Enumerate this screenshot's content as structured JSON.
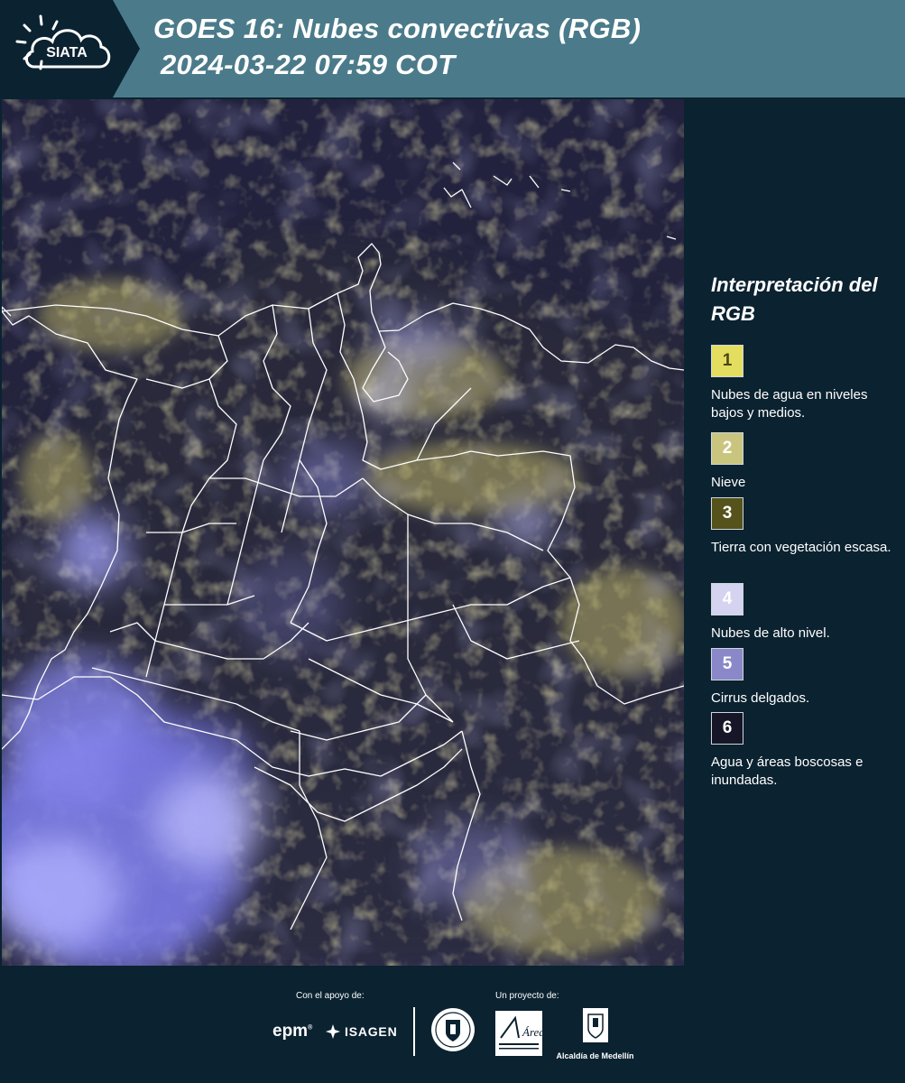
{
  "header": {
    "logo": {
      "text": "SIATA",
      "icon": "sun-cloud-icon"
    },
    "title_line1": "GOES 16: Nubes convectivas (RGB)",
    "title_line2": "2024-03-22 07:59 COT"
  },
  "legend": {
    "title": "Interpretación del RGB",
    "items": [
      {
        "number": "1",
        "label": "Nubes de agua en niveles bajos y medios.",
        "color": "#e3de60",
        "text_color": "#4a4614"
      },
      {
        "number": "2",
        "label": "Nieve",
        "color": "#c9c57e",
        "text_color": "#ffffff"
      },
      {
        "number": "3",
        "label": "Tierra con vegetación escasa.",
        "color": "#56521c",
        "text_color": "#ffffff"
      },
      {
        "number": "4",
        "label": "Nubes de alto nivel.",
        "color": "#d4d4f0",
        "text_color": "#ffffff"
      },
      {
        "number": "5",
        "label": "Cirrus delgados.",
        "color": "#8a88c8",
        "text_color": "#ffffff"
      },
      {
        "number": "6",
        "label": "Agua y áreas boscosas e inundadas.",
        "color": "#161628",
        "text_color": "#ffffff"
      }
    ]
  },
  "footer": {
    "support_label": "Con el apoyo de:",
    "project_label": "Un proyecto de:",
    "sponsors": [
      "epm",
      "ISAGEN"
    ],
    "partners": [
      {
        "name": "Municipio de Medellín",
        "icon": "city-seal-icon"
      },
      {
        "name": "Área Metropolitana Valle de Aburrá",
        "icon": "area-metropolitana-logo"
      },
      {
        "name": "Alcaldía de Medellín",
        "icon": "coat-of-arms-icon"
      }
    ],
    "epm_text": "epm",
    "isagen_text": "ISAGEN",
    "alcaldia_text": "Alcaldía de Medellín",
    "area_text": "Área"
  },
  "colors": {
    "header_bg": "#4b7b8a",
    "page_bg": "#0b2230",
    "map_bg": "#1a1a3c",
    "border_line": "#ffffff",
    "cloud_low": "#c8c068",
    "cloud_high": "#8c8cf0"
  }
}
